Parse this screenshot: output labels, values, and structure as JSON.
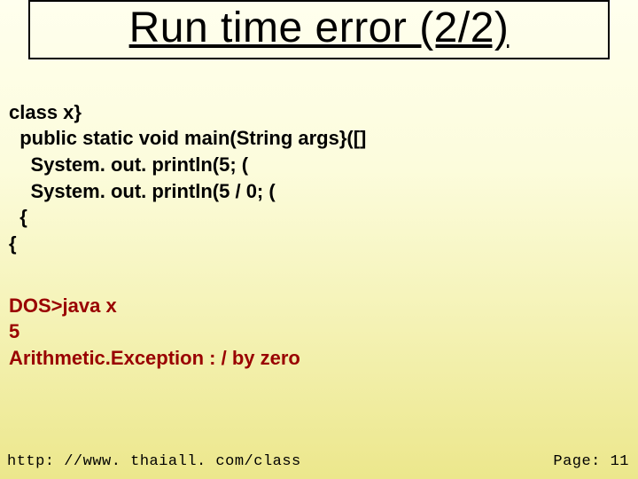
{
  "title": "Run time error (2/2)",
  "code": {
    "l1": "class x}",
    "l2": "  public static void main(String args}([]",
    "l3": "    System. out. println(5; (",
    "l4": "    System. out. println(5 / 0; (",
    "l5": "  {",
    "l6": "{"
  },
  "output": {
    "l1": "DOS>java x",
    "l2": "5",
    "l3": "Arithmetic.Exception : / by zero"
  },
  "footer": {
    "url": "http: //www. thaiall. com/class",
    "page_label": "Page:",
    "page_number": "11"
  }
}
